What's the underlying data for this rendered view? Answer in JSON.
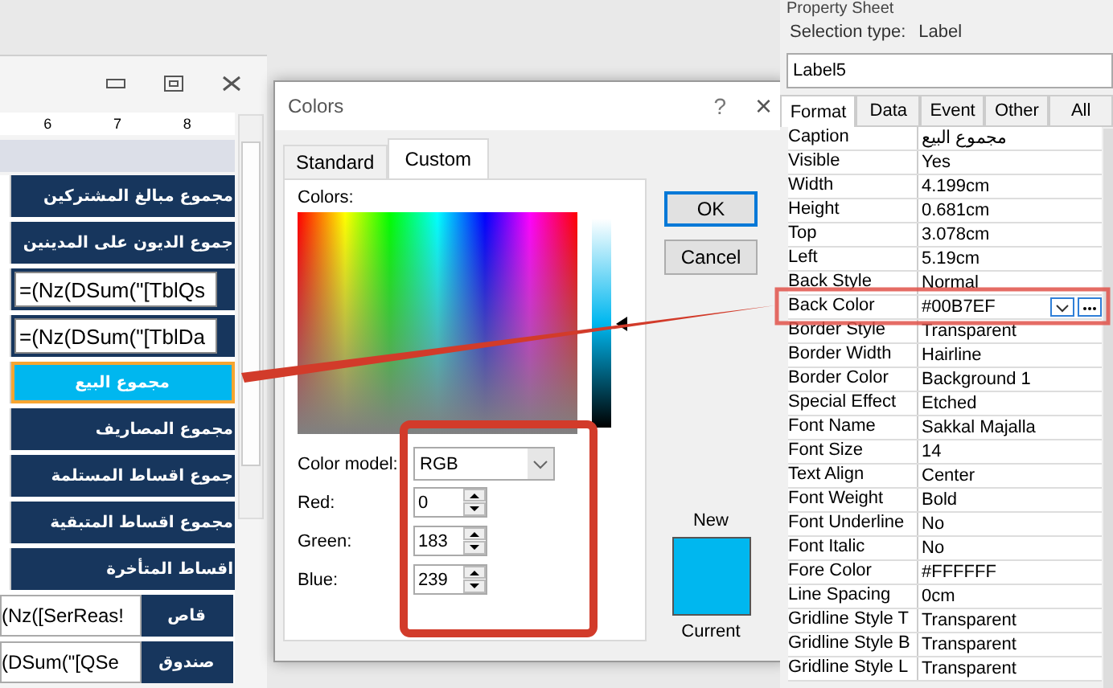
{
  "form_designer": {
    "ruler": [
      "6",
      "7",
      "8"
    ],
    "rows": [
      {
        "kind": "label",
        "text": "مجموع مبالغ المشتركين",
        "selected": false
      },
      {
        "kind": "label",
        "text": "جموع الديون على المدينين",
        "selected": false
      },
      {
        "kind": "textbox",
        "value": "=(Nz(DSum(\"[TblQs"
      },
      {
        "kind": "textbox",
        "value": "=(Nz(DSum(\"[TblDa"
      },
      {
        "kind": "label",
        "text": "مجموع البيع",
        "selected": true
      },
      {
        "kind": "label",
        "text": "مجموع المصاريف",
        "selected": false
      },
      {
        "kind": "label",
        "text": "جموع اقساط المستلمة",
        "selected": false
      },
      {
        "kind": "label",
        "text": "مجموع اقساط المتبقية",
        "selected": false
      },
      {
        "kind": "label",
        "text": "اقساط المتأخرة",
        "selected": false
      },
      {
        "kind": "pair",
        "value": "(Nz([SerReas!",
        "text": "قاص"
      },
      {
        "kind": "pair",
        "value": "(DSum(\"[QSe",
        "text": "صندوق"
      }
    ]
  },
  "colors_dialog": {
    "title": "Colors",
    "help": "?",
    "close": "×",
    "tabs": [
      {
        "label": "Standard",
        "selected": false
      },
      {
        "label": "Custom",
        "selected": true
      }
    ],
    "colors_label": "Colors:",
    "color_model_label": "Color model:",
    "color_model": "RGB",
    "channels": [
      {
        "label": "Red:",
        "value": "0"
      },
      {
        "label": "Green:",
        "value": "183"
      },
      {
        "label": "Blue:",
        "value": "239"
      }
    ],
    "buttons": [
      {
        "label": "OK",
        "default": true
      },
      {
        "label": "Cancel",
        "default": false
      }
    ],
    "new_label": "New",
    "current_label": "Current"
  },
  "property_sheet": {
    "title": "Property Sheet",
    "selection_type_label": "Selection type:",
    "selection_type": "Label",
    "object": "Label5",
    "tabs": [
      {
        "label": "Format",
        "selected": true
      },
      {
        "label": "Data",
        "selected": false
      },
      {
        "label": "Event",
        "selected": false
      },
      {
        "label": "Other",
        "selected": false
      },
      {
        "label": "All",
        "selected": false
      }
    ],
    "properties": [
      {
        "name": "Caption",
        "value": "مجموع البيع",
        "selected": false
      },
      {
        "name": "Visible",
        "value": "Yes",
        "selected": false
      },
      {
        "name": "Width",
        "value": "4.199cm",
        "selected": false
      },
      {
        "name": "Height",
        "value": "0.681cm",
        "selected": false
      },
      {
        "name": "Top",
        "value": "3.078cm",
        "selected": false
      },
      {
        "name": "Left",
        "value": "5.19cm",
        "selected": false
      },
      {
        "name": "Back Style",
        "value": "Normal",
        "selected": false
      },
      {
        "name": "Back Color",
        "value": "#00B7EF",
        "selected": true
      },
      {
        "name": "Border Style",
        "value": "Transparent",
        "selected": false
      },
      {
        "name": "Border Width",
        "value": "Hairline",
        "selected": false
      },
      {
        "name": "Border Color",
        "value": "Background 1",
        "selected": false
      },
      {
        "name": "Special Effect",
        "value": "Etched",
        "selected": false
      },
      {
        "name": "Font Name",
        "value": "Sakkal Majalla",
        "selected": false
      },
      {
        "name": "Font Size",
        "value": "14",
        "selected": false
      },
      {
        "name": "Text Align",
        "value": "Center",
        "selected": false
      },
      {
        "name": "Font Weight",
        "value": "Bold",
        "selected": false
      },
      {
        "name": "Font Underline",
        "value": "No",
        "selected": false
      },
      {
        "name": "Font Italic",
        "value": "No",
        "selected": false
      },
      {
        "name": "Fore Color",
        "value": "#FFFFFF",
        "selected": false
      },
      {
        "name": "Line Spacing",
        "value": "0cm",
        "selected": false
      },
      {
        "name": "Gridline Style T",
        "value": "Transparent",
        "selected": false
      },
      {
        "name": "Gridline Style B",
        "value": "Transparent",
        "selected": false
      },
      {
        "name": "Gridline Style L",
        "value": "Transparent",
        "selected": false
      }
    ]
  }
}
